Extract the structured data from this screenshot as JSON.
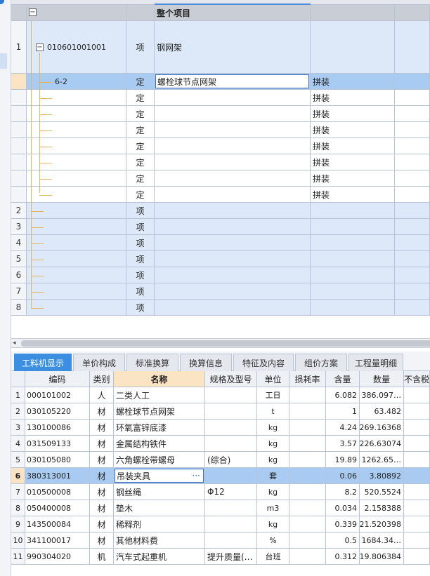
{
  "upper": {
    "total_label": "整个项目",
    "expander_symbol": "−",
    "rows": [
      {
        "num": "1",
        "code": "010601001001",
        "type": "项",
        "name": "钢网架",
        "work": ""
      },
      {
        "num": "",
        "code": "6-2",
        "type": "定",
        "name": "螺栓球节点网架",
        "work": "拼装"
      },
      {
        "num": "",
        "code": "",
        "type": "定",
        "name": "",
        "work": "拼装"
      },
      {
        "num": "",
        "code": "",
        "type": "定",
        "name": "",
        "work": "拼装"
      },
      {
        "num": "",
        "code": "",
        "type": "定",
        "name": "",
        "work": "拼装"
      },
      {
        "num": "",
        "code": "",
        "type": "定",
        "name": "",
        "work": "拼装"
      },
      {
        "num": "",
        "code": "",
        "type": "定",
        "name": "",
        "work": "拼装"
      },
      {
        "num": "",
        "code": "",
        "type": "定",
        "name": "",
        "work": "拼装"
      },
      {
        "num": "",
        "code": "",
        "type": "定",
        "name": "",
        "work": "拼装"
      },
      {
        "num": "2",
        "code": "",
        "type": "项",
        "name": "",
        "work": ""
      },
      {
        "num": "3",
        "code": "",
        "type": "项",
        "name": "",
        "work": ""
      },
      {
        "num": "4",
        "code": "",
        "type": "项",
        "name": "",
        "work": ""
      },
      {
        "num": "5",
        "code": "",
        "type": "项",
        "name": "",
        "work": ""
      },
      {
        "num": "6",
        "code": "",
        "type": "项",
        "name": "",
        "work": ""
      },
      {
        "num": "7",
        "code": "",
        "type": "项",
        "name": "",
        "work": ""
      },
      {
        "num": "8",
        "code": "",
        "type": "项",
        "name": "",
        "work": ""
      }
    ]
  },
  "tabs": [
    "工料机显示",
    "单价构成",
    "标准换算",
    "换算信息",
    "特征及内容",
    "组价方案",
    "工程量明细"
  ],
  "active_tab": 0,
  "lower": {
    "headers": {
      "code": "编码",
      "cat": "类别",
      "name": "名称",
      "spec": "规格及型号",
      "unit": "单位",
      "loss": "损耗率",
      "qty": "含量",
      "amt": "数量",
      "tax": "不含税"
    },
    "rows": [
      {
        "num": "1",
        "code": "000101002",
        "cat": "人",
        "name": "二类人工",
        "spec": "",
        "unit": "工日",
        "qty": "6.082",
        "amt": "386.097…"
      },
      {
        "num": "2",
        "code": "030105220",
        "cat": "材",
        "name": "螺栓球节点网架",
        "spec": "",
        "unit": "t",
        "qty": "1",
        "amt": "63.482"
      },
      {
        "num": "3",
        "code": "130100086",
        "cat": "材",
        "name": "环氧富锌底漆",
        "spec": "",
        "unit": "kg",
        "qty": "4.24",
        "amt": "269.16368"
      },
      {
        "num": "4",
        "code": "031509133",
        "cat": "材",
        "name": "金属结构铁件",
        "spec": "",
        "unit": "kg",
        "qty": "3.57",
        "amt": "226.63074"
      },
      {
        "num": "5",
        "code": "030105080",
        "cat": "材",
        "name": "六角螺栓带螺母",
        "spec": "(综合)",
        "unit": "kg",
        "qty": "19.89",
        "amt": "1262.65…"
      },
      {
        "num": "6",
        "code": "380313001",
        "cat": "材",
        "name": "吊装夹具",
        "spec": "",
        "unit": "套",
        "qty": "0.06",
        "amt": "3.80892"
      },
      {
        "num": "7",
        "code": "010500008",
        "cat": "材",
        "name": "钢丝绳",
        "spec": "Φ12",
        "unit": "kg",
        "qty": "8.2",
        "amt": "520.5524"
      },
      {
        "num": "8",
        "code": "050400008",
        "cat": "材",
        "name": "垫木",
        "spec": "",
        "unit": "m3",
        "qty": "0.034",
        "amt": "2.158388"
      },
      {
        "num": "9",
        "code": "143500084",
        "cat": "材",
        "name": "稀释剂",
        "spec": "",
        "unit": "kg",
        "qty": "0.339",
        "amt": "21.520398"
      },
      {
        "num": "10",
        "code": "341100017",
        "cat": "材",
        "name": "其他材料费",
        "spec": "",
        "unit": "%",
        "qty": "0.5",
        "amt": "1684.34…"
      },
      {
        "num": "11",
        "code": "990304020",
        "cat": "机",
        "name": "汽车式起重机",
        "spec": "提升质量(…",
        "unit": "台班",
        "qty": "0.312",
        "amt": "19.806384"
      }
    ],
    "selected_index": 5,
    "edit_dots": "···"
  },
  "colors": {
    "active_tab": "#3b8ee0",
    "selection": "#a9cbf1",
    "tree_line": "#e8b35c",
    "row_blue": "#dde9f8"
  }
}
